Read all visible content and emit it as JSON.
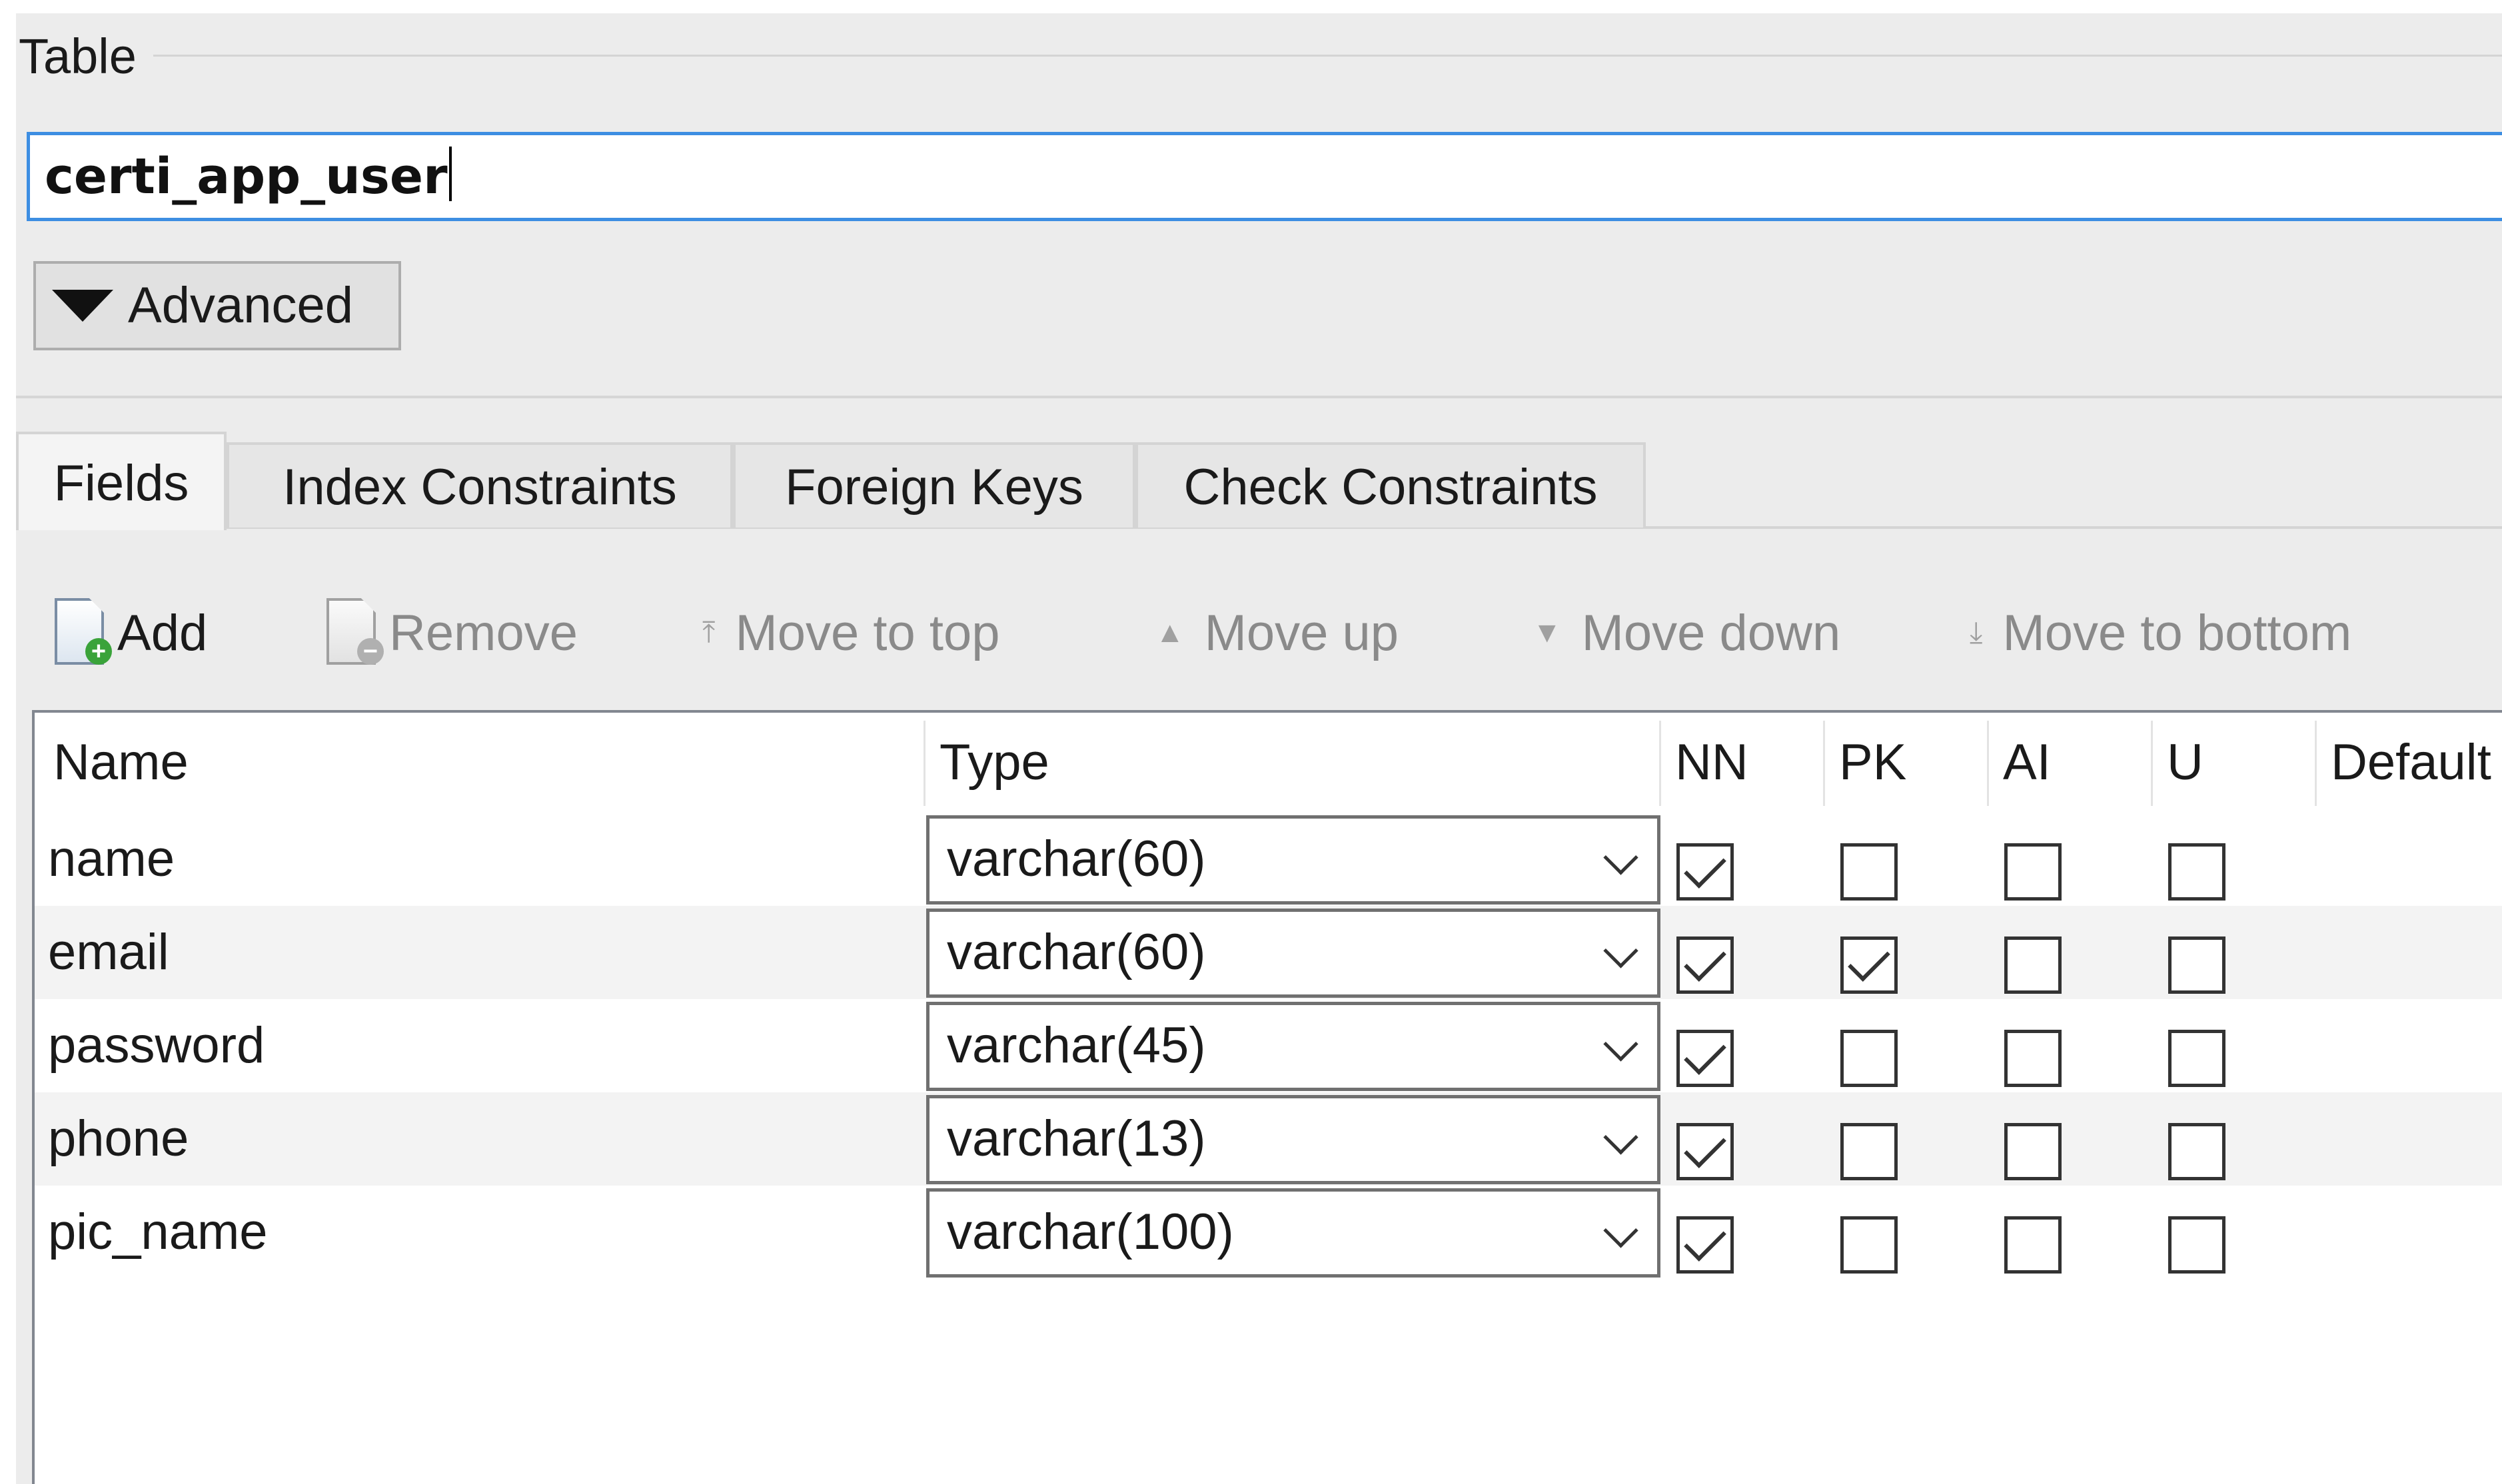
{
  "group": {
    "title": "Table"
  },
  "table_name": {
    "value": "certi_app_user"
  },
  "advanced": {
    "label": "Advanced"
  },
  "tabs": [
    {
      "label": "Fields",
      "active": true
    },
    {
      "label": "Index Constraints",
      "active": false
    },
    {
      "label": "Foreign Keys",
      "active": false
    },
    {
      "label": "Check Constraints",
      "active": false
    }
  ],
  "toolbar": {
    "add": "Add",
    "remove": "Remove",
    "move_to_top": "Move to top",
    "move_up": "Move up",
    "move_down": "Move down",
    "move_to_bottom": "Move to bottom"
  },
  "grid": {
    "columns": [
      "Name",
      "Type",
      "NN",
      "PK",
      "AI",
      "U",
      "Default"
    ],
    "rows": [
      {
        "name": "name",
        "type": "varchar(60)",
        "nn": true,
        "pk": false,
        "ai": false,
        "u": false,
        "default": ""
      },
      {
        "name": "email",
        "type": "varchar(60)",
        "nn": true,
        "pk": true,
        "ai": false,
        "u": false,
        "default": ""
      },
      {
        "name": "password",
        "type": "varchar(45)",
        "nn": true,
        "pk": false,
        "ai": false,
        "u": false,
        "default": ""
      },
      {
        "name": "phone",
        "type": "varchar(13)",
        "nn": true,
        "pk": false,
        "ai": false,
        "u": false,
        "default": ""
      },
      {
        "name": "pic_name",
        "type": "varchar(100)",
        "nn": true,
        "pk": false,
        "ai": false,
        "u": false,
        "default": ""
      }
    ]
  },
  "colors": {
    "focus_border": "#3d8ee2",
    "window_bg": "#ececec",
    "disabled_text": "#8a8a8a"
  }
}
